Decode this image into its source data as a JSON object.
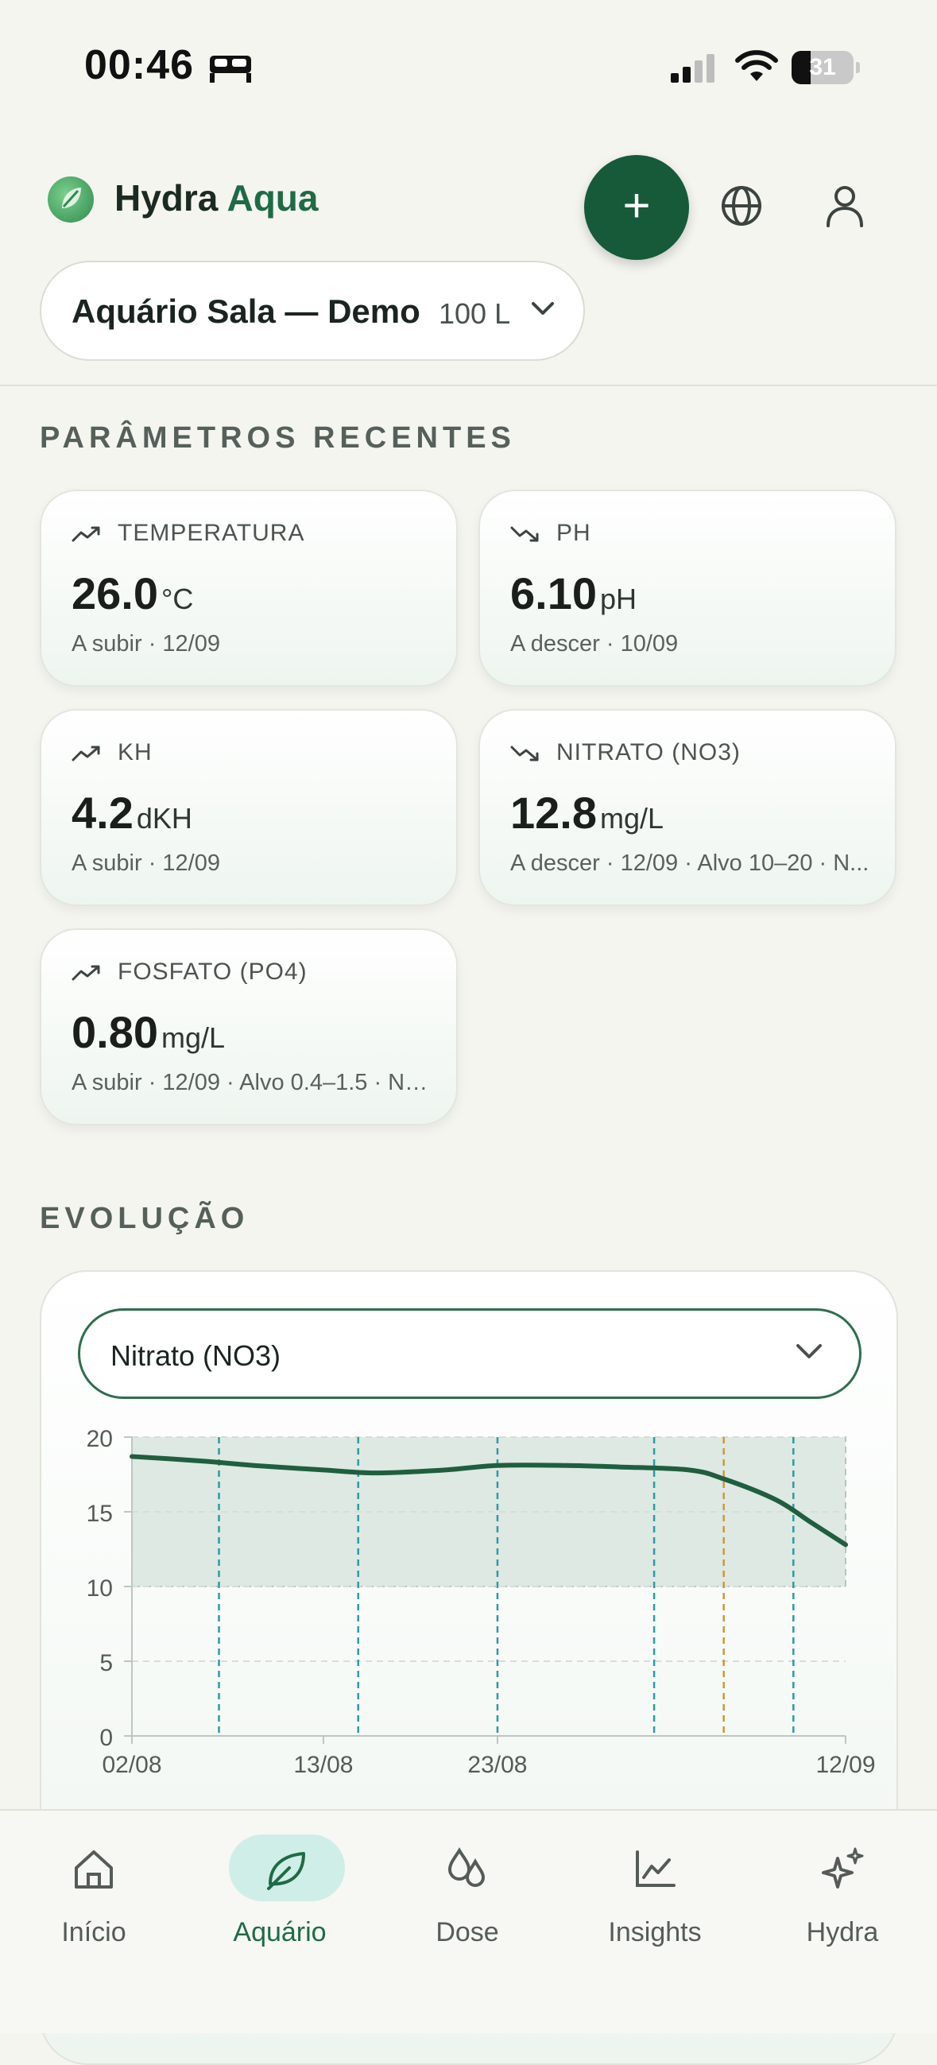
{
  "status_bar": {
    "time": "00:46",
    "battery": "31",
    "battery_level": 0.31
  },
  "header": {
    "app_name_part1": "Hydra",
    "app_name_part2": "Aqua",
    "tank_name": "Aquário Sala — Demo",
    "tank_volume": "100 L"
  },
  "recent_params": {
    "title": "PARÂMETROS RECENTES",
    "cards": [
      {
        "name": "TEMPERATURA",
        "value": "26.0",
        "unit": "°C",
        "meta": "A subir · 12/09",
        "trend": "up"
      },
      {
        "name": "PH",
        "value": "6.10",
        "unit": "pH",
        "meta": "A descer · 10/09",
        "trend": "down"
      },
      {
        "name": "KH",
        "value": "4.2",
        "unit": "dKH",
        "meta": "A subir · 12/09",
        "trend": "up"
      },
      {
        "name": "NITRATO (NO3)",
        "value": "12.8",
        "unit": "mg/L",
        "meta": "A descer · 12/09 · Alvo 10–20 · N...",
        "trend": "down"
      },
      {
        "name": "FOSFATO (PO4)",
        "value": "0.80",
        "unit": "mg/L",
        "meta": "A subir · 12/09 · Alvo 0.4–1.5 · No ...",
        "trend": "up"
      }
    ]
  },
  "evolution": {
    "title": "EVOLUÇÃO",
    "selected_param": "Nitrato (NO3)"
  },
  "chart_data": {
    "type": "line",
    "x": [
      "02/08",
      "06/08",
      "09/08",
      "13/08",
      "16/08",
      "20/08",
      "23/08",
      "27/08",
      "30/08",
      "03/09",
      "05/09",
      "08/09",
      "10/09",
      "12/09"
    ],
    "x_tick_labels": [
      "02/08",
      "13/08",
      "23/08",
      "12/09"
    ],
    "series": [
      {
        "values": [
          18.7,
          18.4,
          18.1,
          17.8,
          17.6,
          17.8,
          18.1,
          18.1,
          18.0,
          17.8,
          17.2,
          15.8,
          14.3,
          12.8
        ]
      }
    ],
    "ylim": [
      0,
      20
    ],
    "y_ticks": [
      0,
      5,
      10,
      15,
      20
    ],
    "target_band": [
      10,
      20
    ],
    "event_markers": [
      "07/08",
      "15/08",
      "23/08",
      "01/09",
      "09/09"
    ],
    "highlight_marker": "05/09",
    "grid": true,
    "colors": {
      "line": "#1f5e3f",
      "band": "#dde9e2",
      "marker": "#2a9ca5",
      "highlight": "#c89a3c"
    }
  },
  "nav": {
    "items": [
      {
        "label": "Início",
        "icon": "home-icon"
      },
      {
        "label": "Aquário",
        "icon": "leaf-icon",
        "active": true
      },
      {
        "label": "Dose",
        "icon": "drops-icon"
      },
      {
        "label": "Insights",
        "icon": "chart-icon"
      },
      {
        "label": "Hydra",
        "icon": "sparkles-icon"
      }
    ]
  }
}
